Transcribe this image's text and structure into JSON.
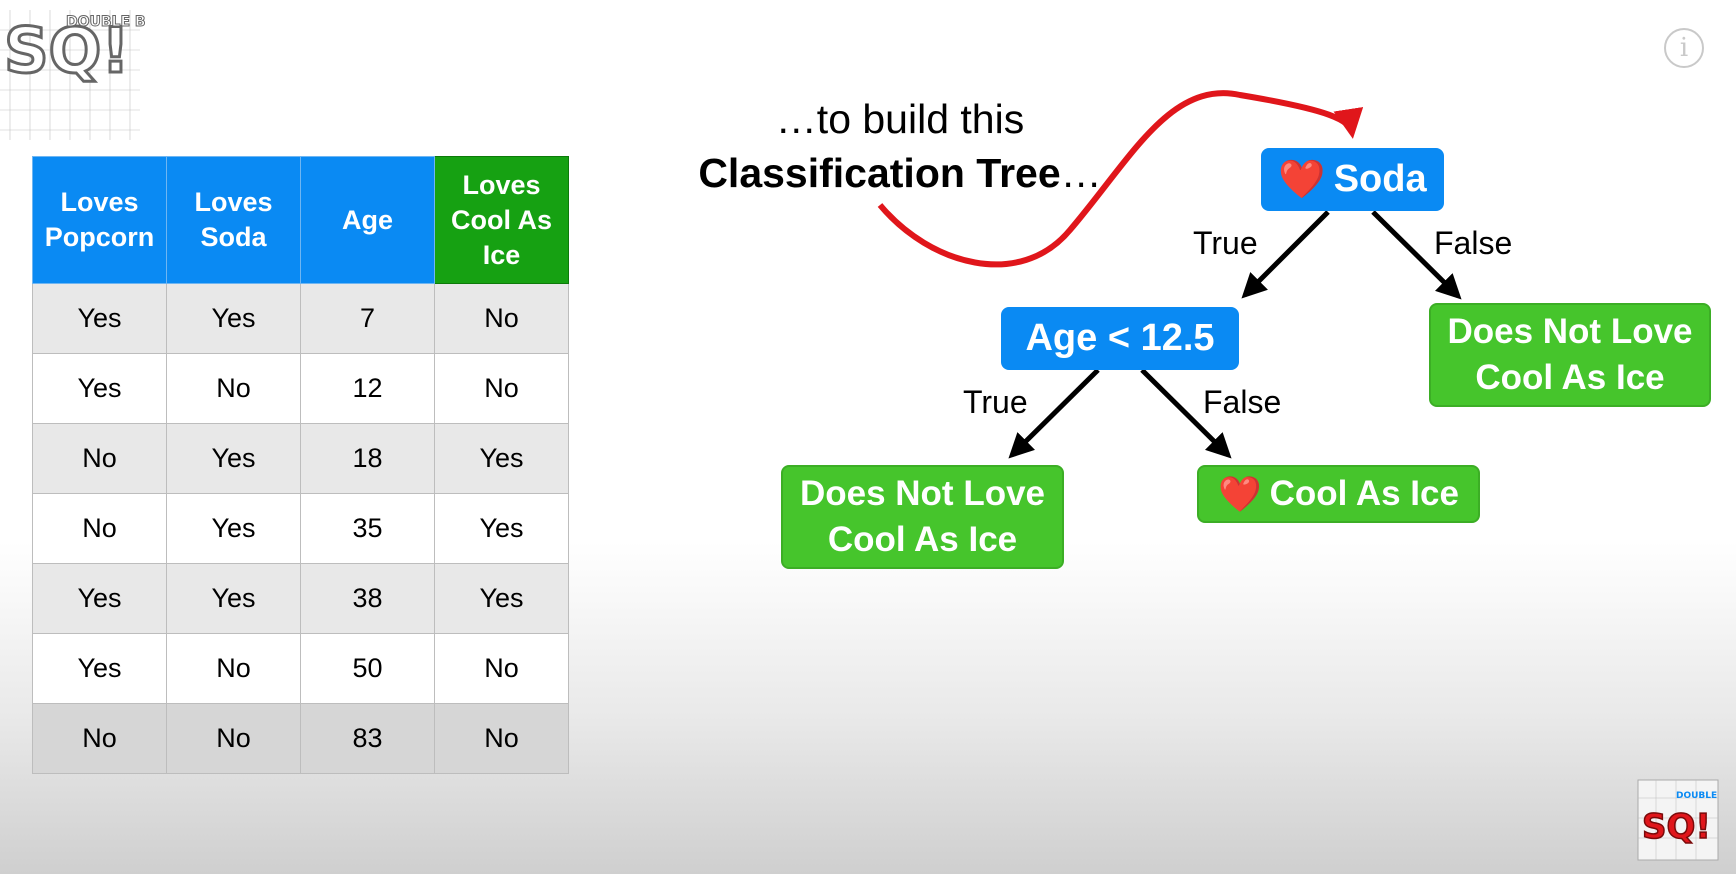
{
  "logo": {
    "top_text": "DOUBLE BAM!!",
    "letters": "SQ!",
    "icon": "statquest-logo"
  },
  "info_button": {
    "label": "i",
    "icon": "info-icon"
  },
  "table": {
    "headers": [
      {
        "lines": [
          "Loves",
          "Popcorn"
        ]
      },
      {
        "lines": [
          "Loves",
          "Soda"
        ]
      },
      {
        "lines": [
          "Age"
        ]
      },
      {
        "lines": [
          "Loves",
          "Cool As",
          "Ice"
        ]
      }
    ],
    "rows": [
      [
        "Yes",
        "Yes",
        "7",
        "No"
      ],
      [
        "Yes",
        "No",
        "12",
        "No"
      ],
      [
        "No",
        "Yes",
        "18",
        "Yes"
      ],
      [
        "No",
        "Yes",
        "35",
        "Yes"
      ],
      [
        "Yes",
        "Yes",
        "38",
        "Yes"
      ],
      [
        "Yes",
        "No",
        "50",
        "No"
      ],
      [
        "No",
        "No",
        "83",
        "No"
      ]
    ]
  },
  "heading": {
    "line1": "…to build this",
    "line2_bold": "Classification Tree",
    "line2_rest": "…"
  },
  "tree": {
    "root": {
      "heart": "❤️",
      "label": "Soda"
    },
    "left_branch_label": "True",
    "right_branch_label": "False",
    "age_node": "Age < 12.5",
    "age_true_label": "True",
    "age_false_label": "False",
    "leaf_right": [
      "Does Not Love",
      "Cool As Ice"
    ],
    "leaf_left": [
      "Does Not Love",
      "Cool As Ice"
    ],
    "leaf_mid": {
      "heart": "❤️",
      "label": "Cool As Ice"
    }
  },
  "colors": {
    "header_blue": "#0a8af3",
    "header_green": "#16a112",
    "leaf_green": "#46c52c",
    "arrow_red": "#e0161b"
  }
}
